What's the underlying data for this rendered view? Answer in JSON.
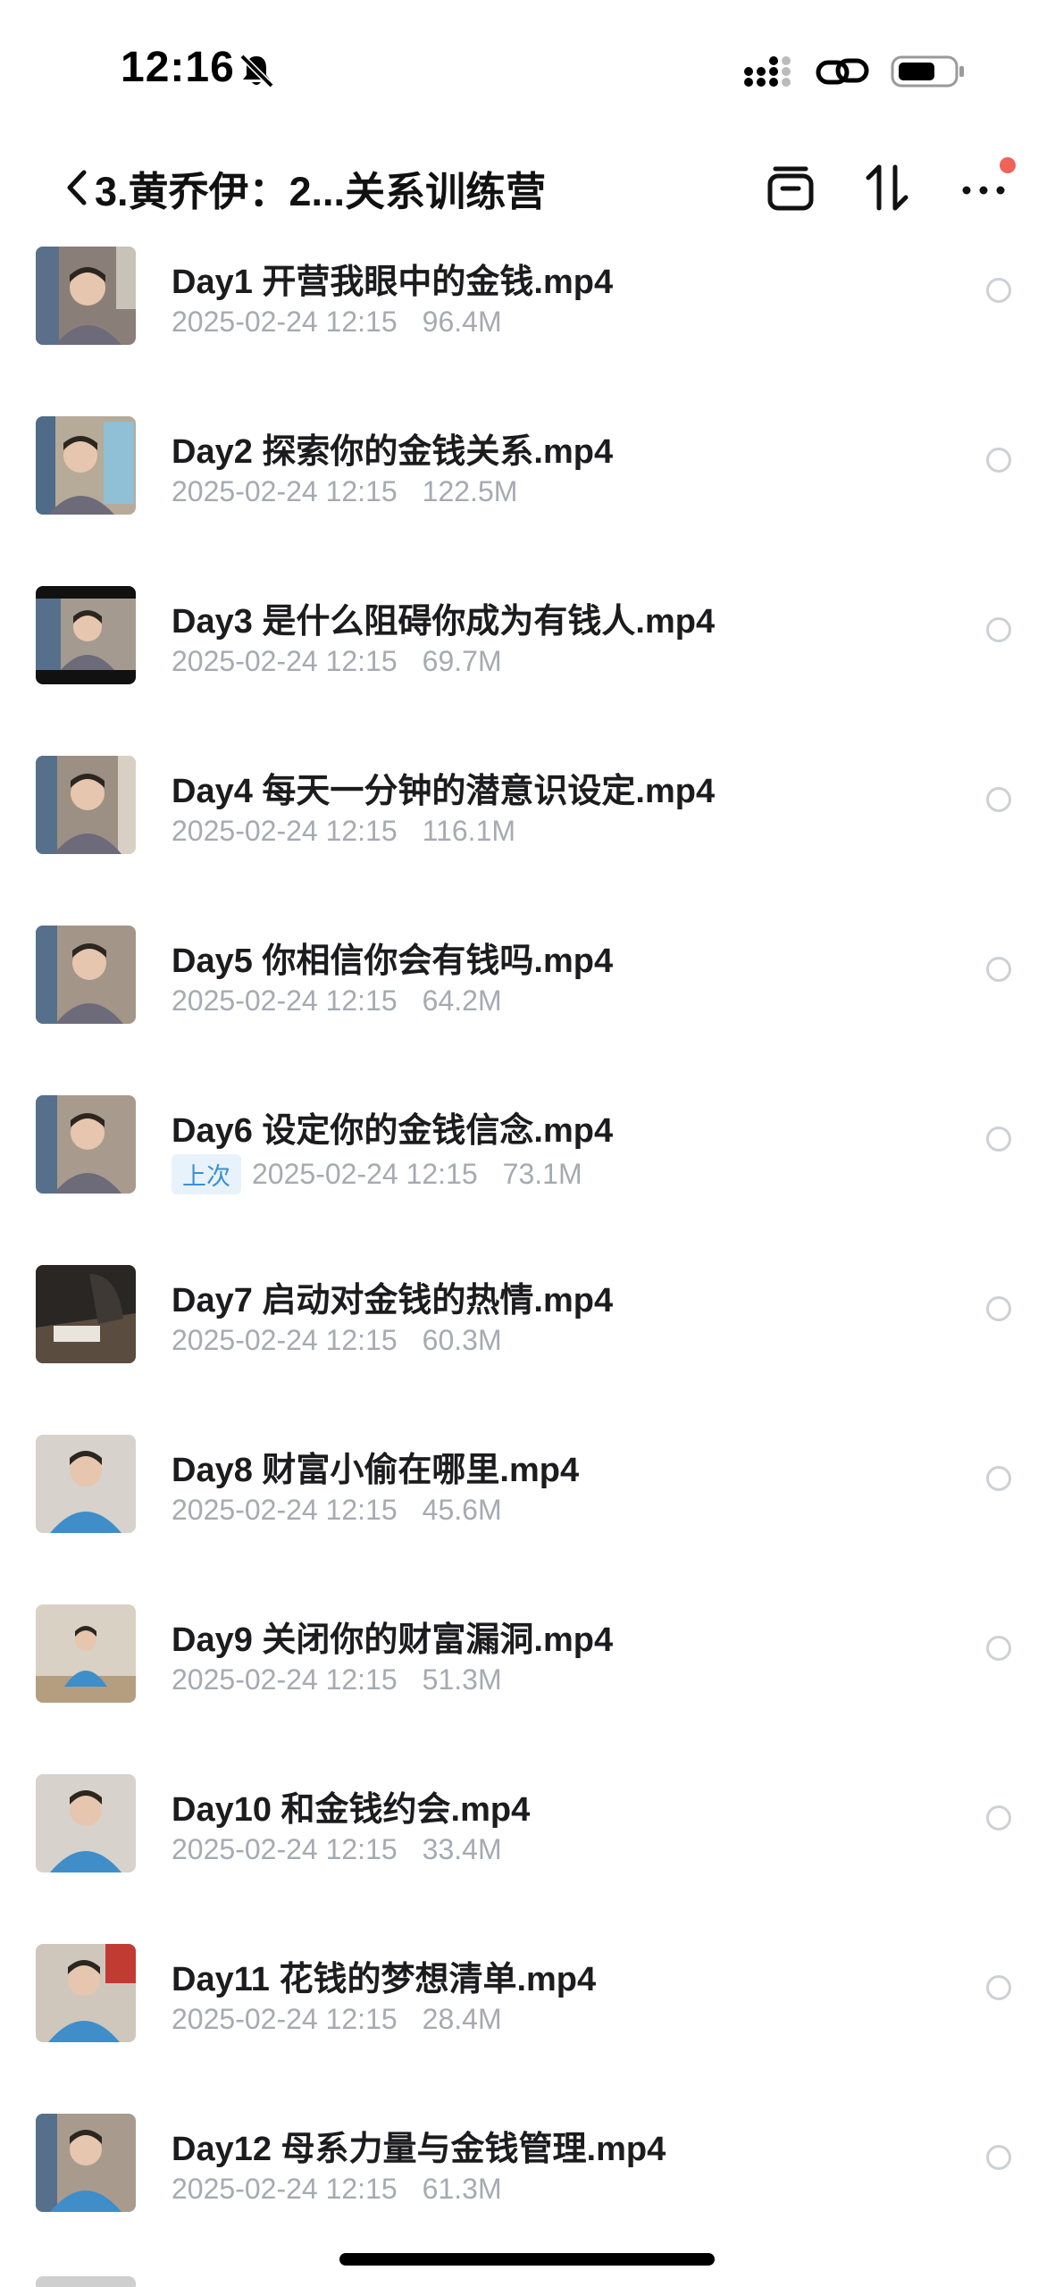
{
  "status_bar": {
    "time": "12:16",
    "icons": [
      "bell-muted-icon",
      "signal-icon",
      "link-icon",
      "battery-icon"
    ]
  },
  "header": {
    "title": "3.黄乔伊：2...关系训练营",
    "actions": [
      "archive-icon",
      "sort-icon",
      "more-icon"
    ],
    "notification_dot_color": "#f0625a"
  },
  "files": [
    {
      "name": "Day1 开营我眼中的金钱.mp4",
      "date": "2025-02-24 12:15",
      "size": "96.4M",
      "badge": ""
    },
    {
      "name": "Day2 探索你的金钱关系.mp4",
      "date": "2025-02-24 12:15",
      "size": "122.5M",
      "badge": ""
    },
    {
      "name": "Day3 是什么阻碍你成为有钱人.mp4",
      "date": "2025-02-24 12:15",
      "size": "69.7M",
      "badge": ""
    },
    {
      "name": "Day4 每天一分钟的潜意识设定.mp4",
      "date": "2025-02-24 12:15",
      "size": "116.1M",
      "badge": ""
    },
    {
      "name": "Day5 你相信你会有钱吗.mp4",
      "date": "2025-02-24 12:15",
      "size": "64.2M",
      "badge": ""
    },
    {
      "name": "Day6 设定你的金钱信念.mp4",
      "date": "2025-02-24 12:15",
      "size": "73.1M",
      "badge": "上次"
    },
    {
      "name": "Day7 启动对金钱的热情.mp4",
      "date": "2025-02-24 12:15",
      "size": "60.3M",
      "badge": ""
    },
    {
      "name": "Day8 财富小偷在哪里.mp4",
      "date": "2025-02-24 12:15",
      "size": "45.6M",
      "badge": ""
    },
    {
      "name": "Day9 关闭你的财富漏洞.mp4",
      "date": "2025-02-24 12:15",
      "size": "51.3M",
      "badge": ""
    },
    {
      "name": "Day10 和金钱约会.mp4",
      "date": "2025-02-24 12:15",
      "size": "33.4M",
      "badge": ""
    },
    {
      "name": "Day11 花钱的梦想清单.mp4",
      "date": "2025-02-24 12:15",
      "size": "28.4M",
      "badge": ""
    },
    {
      "name": "Day12 母系力量与金钱管理.mp4",
      "date": "2025-02-24 12:15",
      "size": "61.3M",
      "badge": ""
    }
  ],
  "colors": {
    "accent_blue": "#3c8fd0",
    "meta_gray": "#a6aab1",
    "radio_gray": "#cdd0d4"
  }
}
